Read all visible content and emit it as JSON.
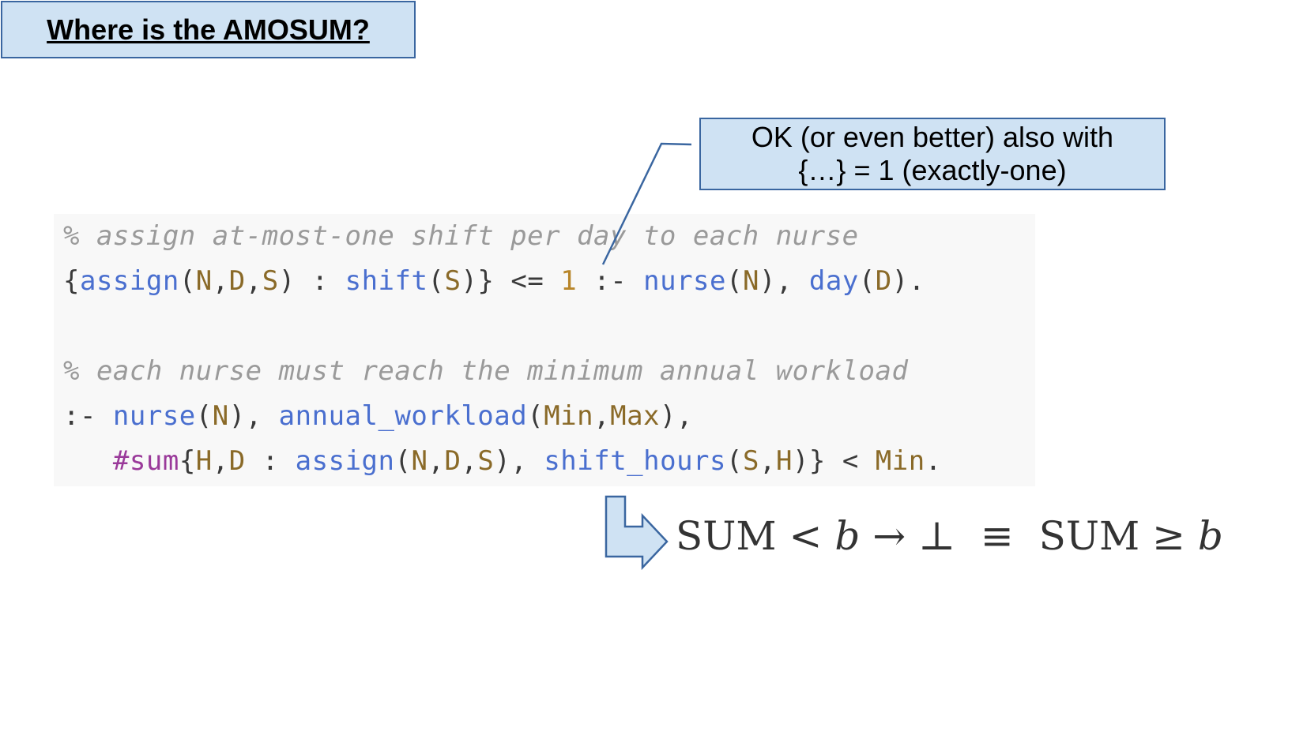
{
  "title": "Where is the AMOSUM?",
  "callout": {
    "line1": "OK (or even better) also with",
    "line2": "{…} = 1 (exactly-one)"
  },
  "code": {
    "comment1": "% assign at-most-one shift per day to each nurse",
    "comment2": "% each nurse must reach the minimum annual workload"
  },
  "formula": {
    "sum_left": "SUM",
    "lt": "<",
    "b1": "b",
    "arrow": "→",
    "bottom": "⊥",
    "equiv": "≡",
    "sum_right": "SUM",
    "geq": "≥",
    "b2": "b"
  },
  "colors": {
    "box_fill": "#cfe2f3",
    "box_border": "#3a66a0",
    "code_bg": "#f8f8f8",
    "function": "#4a6fcf",
    "comment": "#9a9a9a",
    "aggregate": "#9a3a9a"
  }
}
